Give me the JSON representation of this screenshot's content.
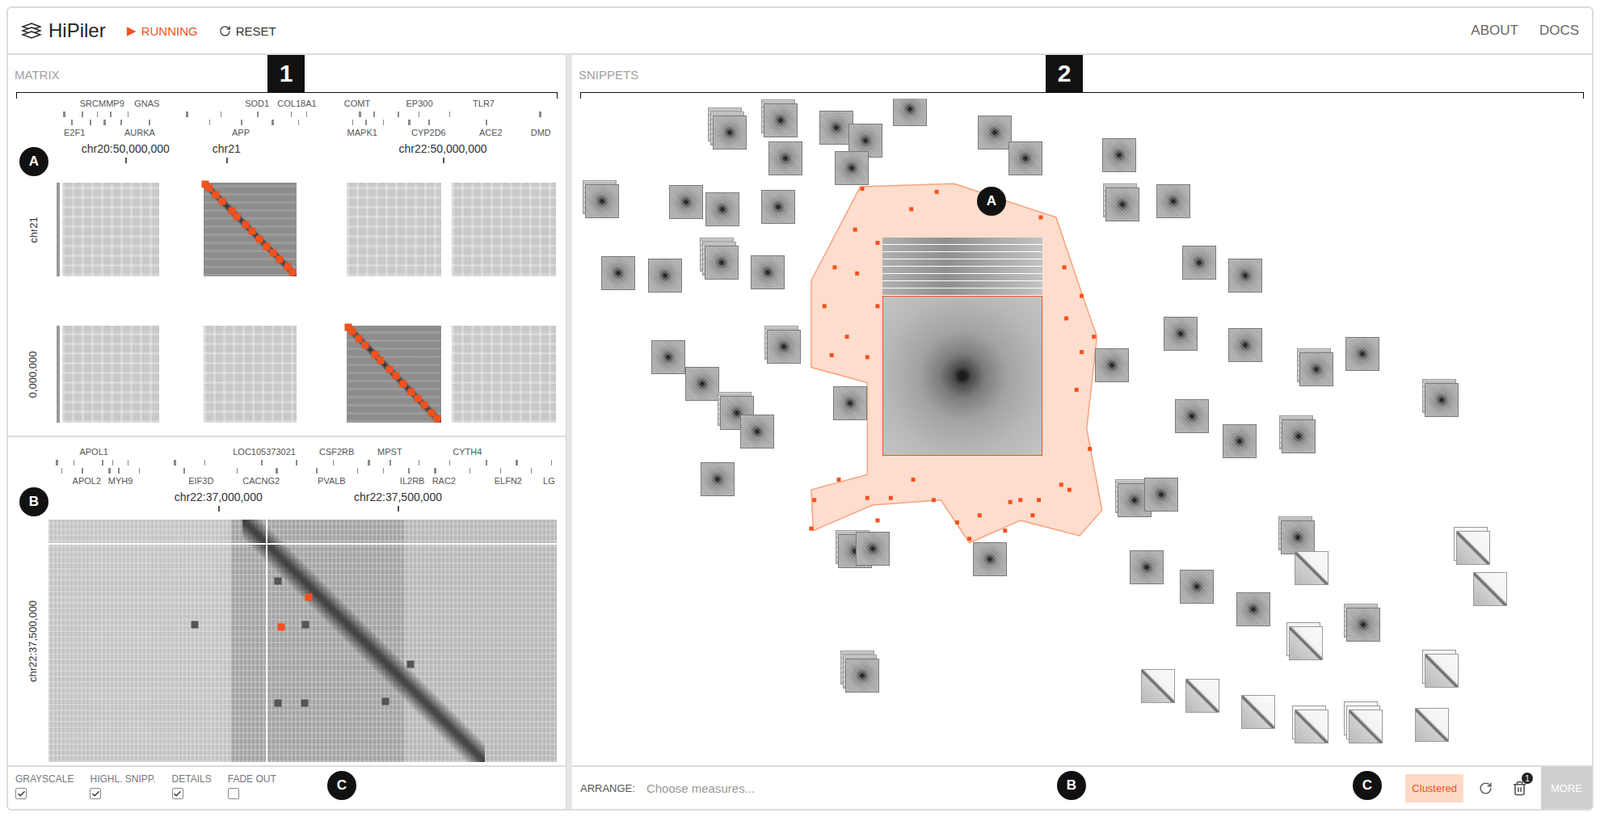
{
  "app": {
    "title": "HiPiler",
    "run": {
      "icon": "▶",
      "label": "RUNNING",
      "on": true
    },
    "reset": "RESET",
    "nav": [
      "ABOUT",
      "DOCS"
    ]
  },
  "callouts": {
    "matrix": "1",
    "snippets": "2",
    "matrix_parts": [
      "A",
      "B",
      "C"
    ],
    "snippet_parts": [
      "A",
      "B",
      "C"
    ]
  },
  "matrix": {
    "title": "MATRIX",
    "overview": {
      "genes_top": [
        "SRCMMP9",
        "GNAS",
        "SOD1",
        "COL18A1",
        "COMT",
        "EP300",
        "TLR7"
      ],
      "genes_bottom": [
        "E2F1",
        "AURKA",
        "APP",
        "MAPK1",
        "CYP2D6",
        "ACE2",
        "DMD"
      ],
      "axis_x": [
        "chr20:50,000,000",
        "chr21",
        "chr22:50,000,000"
      ],
      "rows": [
        {
          "label": "chr21",
          "blocks": [
            {
              "highlighted": false
            },
            {
              "highlighted": true
            },
            {
              "highlighted": false
            },
            {
              "highlighted": false
            }
          ]
        },
        {
          "label": "0,000,000",
          "blocks": [
            {
              "highlighted": false
            },
            {
              "highlighted": false
            },
            {
              "highlighted": true
            },
            {
              "highlighted": false
            }
          ]
        }
      ]
    },
    "detail": {
      "genes_top": [
        "APOL1",
        "LOC105373021",
        "CSF2RB",
        "MPST",
        "CYTH4"
      ],
      "genes_bottom": [
        "APOL2",
        "MYH9",
        "EIF3D",
        "CACNG2",
        "PVALB",
        "IL2RB",
        "RAC2",
        "ELFN2",
        "LG"
      ],
      "axis_x": [
        "chr22:37,000,000",
        "chr22:37,500,000"
      ],
      "axis_y": "chr22:37,500,000",
      "markers": [
        {
          "highlighted": true
        },
        {
          "highlighted": true
        },
        {
          "highlighted": false
        },
        {
          "highlighted": false
        },
        {
          "highlighted": false
        },
        {
          "highlighted": false
        },
        {
          "highlighted": false
        },
        {
          "highlighted": false
        },
        {
          "highlighted": false
        }
      ]
    },
    "options": [
      {
        "label": "GRAYSCALE",
        "checked": true
      },
      {
        "label": "HIGHL. SNIPP.",
        "checked": true
      },
      {
        "label": "DETAILS",
        "checked": true
      },
      {
        "label": "FADE OUT",
        "checked": false
      }
    ]
  },
  "snippets": {
    "title": "SNIPPETS",
    "piles": [
      {
        "kind": "loop",
        "stack": 3
      },
      {
        "kind": "loop",
        "stack": 2
      },
      {
        "kind": "loop",
        "stack": 1
      },
      {
        "kind": "loop",
        "stack": 1
      },
      {
        "kind": "loop",
        "stack": 1
      },
      {
        "kind": "loop",
        "stack": 1
      },
      {
        "kind": "loop",
        "stack": 1
      },
      {
        "kind": "loop",
        "stack": 1
      },
      {
        "kind": "loop",
        "stack": 1
      },
      {
        "kind": "loop",
        "stack": 1
      },
      {
        "kind": "loop",
        "stack": 2
      },
      {
        "kind": "loop",
        "stack": 1
      },
      {
        "kind": "loop",
        "stack": 1
      },
      {
        "kind": "loop",
        "stack": 1
      },
      {
        "kind": "loop",
        "stack": 2
      },
      {
        "kind": "loop",
        "stack": 1
      },
      {
        "kind": "loop",
        "stack": 1
      },
      {
        "kind": "loop",
        "stack": 1
      },
      {
        "kind": "loop",
        "stack": 3
      },
      {
        "kind": "loop",
        "stack": 1
      },
      {
        "kind": "loop",
        "stack": 1
      },
      {
        "kind": "loop",
        "stack": 1
      },
      {
        "kind": "loop",
        "stack": 1
      },
      {
        "kind": "loop",
        "stack": 1
      },
      {
        "kind": "loop",
        "stack": 2
      },
      {
        "kind": "loop",
        "stack": 1
      },
      {
        "kind": "loop",
        "stack": 2
      },
      {
        "kind": "loop",
        "stack": 1
      },
      {
        "kind": "loop",
        "stack": 1
      },
      {
        "kind": "loop",
        "stack": 1
      },
      {
        "kind": "loop",
        "stack": 1
      },
      {
        "kind": "loop",
        "stack": 2
      },
      {
        "kind": "loop",
        "stack": 1
      },
      {
        "kind": "loop",
        "stack": 1
      },
      {
        "kind": "loop",
        "stack": 1
      },
      {
        "kind": "loop",
        "stack": 2
      },
      {
        "kind": "loop",
        "stack": 2
      },
      {
        "kind": "loop",
        "stack": 1
      },
      {
        "kind": "loop",
        "stack": 2
      },
      {
        "kind": "loop",
        "stack": 1
      },
      {
        "kind": "loop",
        "stack": 1
      },
      {
        "kind": "loop",
        "stack": 2
      },
      {
        "kind": "loop",
        "stack": 1
      },
      {
        "kind": "loop",
        "stack": 1
      },
      {
        "kind": "loop",
        "stack": 1
      },
      {
        "kind": "loop",
        "stack": 2
      },
      {
        "kind": "diagonal",
        "stack": 1
      },
      {
        "kind": "loop",
        "stack": 1
      },
      {
        "kind": "loop",
        "stack": 2
      },
      {
        "kind": "diagonal",
        "stack": 2
      },
      {
        "kind": "diagonal",
        "stack": 1
      },
      {
        "kind": "diagonal",
        "stack": 2
      },
      {
        "kind": "diagonal",
        "stack": 1
      },
      {
        "kind": "diagonal",
        "stack": 1
      },
      {
        "kind": "diagonal",
        "stack": 1
      },
      {
        "kind": "diagonal",
        "stack": 2
      },
      {
        "kind": "diagonal",
        "stack": 3
      },
      {
        "kind": "diagonal",
        "stack": 1
      },
      {
        "kind": "diagonal",
        "stack": 2
      },
      {
        "kind": "loop",
        "stack": 3
      }
    ],
    "cluster": {
      "selected": true,
      "stack": 8
    },
    "arrange": {
      "label": "ARRANGE:",
      "placeholder": "Choose measures..."
    },
    "clustered": {
      "label": "Clustered",
      "selected": true
    },
    "trash_count": "1",
    "more": "MORE"
  }
}
